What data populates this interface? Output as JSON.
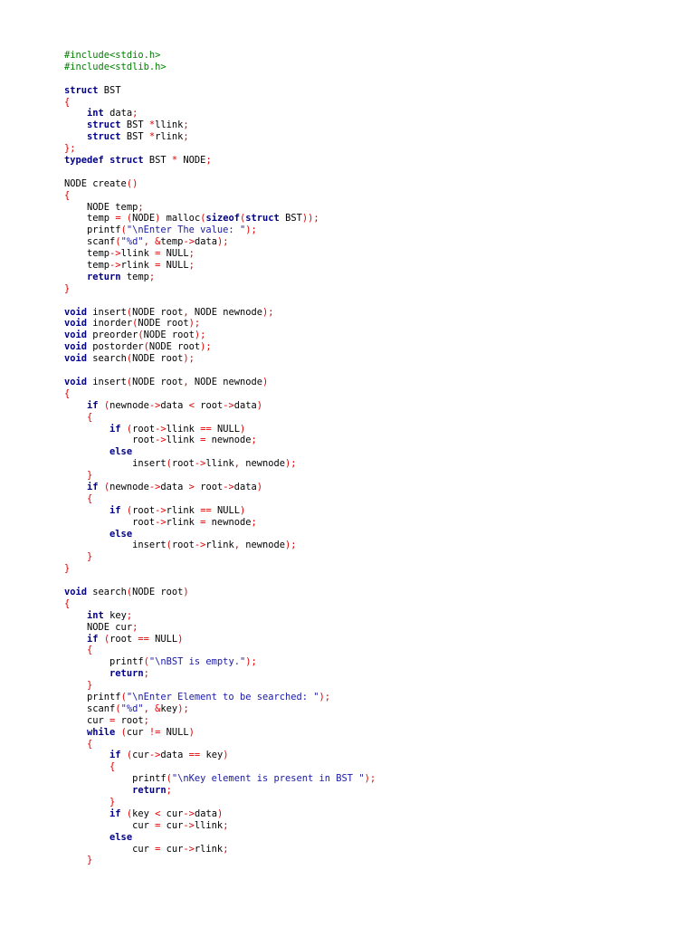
{
  "colors": {
    "preprocessor": "#008000",
    "keyword": "#00008b",
    "string": "#1a1aa6",
    "operator": "#e00000",
    "text": "#000000",
    "background": "#ffffff"
  },
  "code": {
    "lines": [
      [
        [
          "pp",
          "#include<stdio.h>"
        ]
      ],
      [
        [
          "pp",
          "#include<stdlib.h>"
        ]
      ],
      [],
      [
        [
          "kw",
          "struct"
        ],
        [
          "tx",
          " BST"
        ]
      ],
      [
        [
          "op",
          "{"
        ]
      ],
      [
        [
          "tx",
          "    "
        ],
        [
          "kw",
          "int"
        ],
        [
          "tx",
          " data"
        ],
        [
          "op",
          ";"
        ]
      ],
      [
        [
          "tx",
          "    "
        ],
        [
          "kw",
          "struct"
        ],
        [
          "tx",
          " BST "
        ],
        [
          "op",
          "*"
        ],
        [
          "tx",
          "llink"
        ],
        [
          "op",
          ";"
        ]
      ],
      [
        [
          "tx",
          "    "
        ],
        [
          "kw",
          "struct"
        ],
        [
          "tx",
          " BST "
        ],
        [
          "op",
          "*"
        ],
        [
          "tx",
          "rlink"
        ],
        [
          "op",
          ";"
        ]
      ],
      [
        [
          "op",
          "};"
        ]
      ],
      [
        [
          "kw",
          "typedef"
        ],
        [
          "tx",
          " "
        ],
        [
          "kw",
          "struct"
        ],
        [
          "tx",
          " BST "
        ],
        [
          "op",
          "*"
        ],
        [
          "tx",
          " NODE"
        ],
        [
          "op",
          ";"
        ]
      ],
      [],
      [
        [
          "tx",
          "NODE create"
        ],
        [
          "op",
          "()"
        ]
      ],
      [
        [
          "op",
          "{"
        ]
      ],
      [
        [
          "tx",
          "    NODE temp"
        ],
        [
          "op",
          ";"
        ]
      ],
      [
        [
          "tx",
          "    temp "
        ],
        [
          "op",
          "="
        ],
        [
          "tx",
          " "
        ],
        [
          "op",
          "("
        ],
        [
          "tx",
          "NODE"
        ],
        [
          "op",
          ")"
        ],
        [
          "tx",
          " malloc"
        ],
        [
          "op",
          "("
        ],
        [
          "kw",
          "sizeof"
        ],
        [
          "op",
          "("
        ],
        [
          "kw",
          "struct"
        ],
        [
          "tx",
          " BST"
        ],
        [
          "op",
          "));"
        ]
      ],
      [
        [
          "tx",
          "    printf"
        ],
        [
          "op",
          "("
        ],
        [
          "st",
          "\"\\nEnter The value: \""
        ],
        [
          "op",
          ");"
        ]
      ],
      [
        [
          "tx",
          "    scanf"
        ],
        [
          "op",
          "("
        ],
        [
          "st",
          "\"%d\""
        ],
        [
          "op",
          ","
        ],
        [
          "tx",
          " "
        ],
        [
          "op",
          "&"
        ],
        [
          "tx",
          "temp"
        ],
        [
          "op",
          "->"
        ],
        [
          "tx",
          "data"
        ],
        [
          "op",
          ");"
        ]
      ],
      [
        [
          "tx",
          "    temp"
        ],
        [
          "op",
          "->"
        ],
        [
          "tx",
          "llink "
        ],
        [
          "op",
          "="
        ],
        [
          "tx",
          " NULL"
        ],
        [
          "op",
          ";"
        ]
      ],
      [
        [
          "tx",
          "    temp"
        ],
        [
          "op",
          "->"
        ],
        [
          "tx",
          "rlink "
        ],
        [
          "op",
          "="
        ],
        [
          "tx",
          " NULL"
        ],
        [
          "op",
          ";"
        ]
      ],
      [
        [
          "tx",
          "    "
        ],
        [
          "kw",
          "return"
        ],
        [
          "tx",
          " temp"
        ],
        [
          "op",
          ";"
        ]
      ],
      [
        [
          "op",
          "}"
        ]
      ],
      [],
      [
        [
          "kw",
          "void"
        ],
        [
          "tx",
          " insert"
        ],
        [
          "op",
          "("
        ],
        [
          "tx",
          "NODE root"
        ],
        [
          "op",
          ","
        ],
        [
          "tx",
          " NODE newnode"
        ],
        [
          "op",
          ");"
        ]
      ],
      [
        [
          "kw",
          "void"
        ],
        [
          "tx",
          " inorder"
        ],
        [
          "op",
          "("
        ],
        [
          "tx",
          "NODE root"
        ],
        [
          "op",
          ");"
        ]
      ],
      [
        [
          "kw",
          "void"
        ],
        [
          "tx",
          " preorder"
        ],
        [
          "op",
          "("
        ],
        [
          "tx",
          "NODE root"
        ],
        [
          "op",
          ");"
        ]
      ],
      [
        [
          "kw",
          "void"
        ],
        [
          "tx",
          " postorder"
        ],
        [
          "op",
          "("
        ],
        [
          "tx",
          "NODE root"
        ],
        [
          "op",
          ");"
        ]
      ],
      [
        [
          "kw",
          "void"
        ],
        [
          "tx",
          " search"
        ],
        [
          "op",
          "("
        ],
        [
          "tx",
          "NODE root"
        ],
        [
          "op",
          ");"
        ]
      ],
      [],
      [
        [
          "kw",
          "void"
        ],
        [
          "tx",
          " insert"
        ],
        [
          "op",
          "("
        ],
        [
          "tx",
          "NODE root"
        ],
        [
          "op",
          ","
        ],
        [
          "tx",
          " NODE newnode"
        ],
        [
          "op",
          ")"
        ]
      ],
      [
        [
          "op",
          "{"
        ]
      ],
      [
        [
          "tx",
          "    "
        ],
        [
          "kw",
          "if"
        ],
        [
          "tx",
          " "
        ],
        [
          "op",
          "("
        ],
        [
          "tx",
          "newnode"
        ],
        [
          "op",
          "->"
        ],
        [
          "tx",
          "data "
        ],
        [
          "op",
          "<"
        ],
        [
          "tx",
          " root"
        ],
        [
          "op",
          "->"
        ],
        [
          "tx",
          "data"
        ],
        [
          "op",
          ")"
        ]
      ],
      [
        [
          "tx",
          "    "
        ],
        [
          "op",
          "{"
        ]
      ],
      [
        [
          "tx",
          "        "
        ],
        [
          "kw",
          "if"
        ],
        [
          "tx",
          " "
        ],
        [
          "op",
          "("
        ],
        [
          "tx",
          "root"
        ],
        [
          "op",
          "->"
        ],
        [
          "tx",
          "llink "
        ],
        [
          "op",
          "=="
        ],
        [
          "tx",
          " NULL"
        ],
        [
          "op",
          ")"
        ]
      ],
      [
        [
          "tx",
          "            root"
        ],
        [
          "op",
          "->"
        ],
        [
          "tx",
          "llink "
        ],
        [
          "op",
          "="
        ],
        [
          "tx",
          " newnode"
        ],
        [
          "op",
          ";"
        ]
      ],
      [
        [
          "tx",
          "        "
        ],
        [
          "kw",
          "else"
        ]
      ],
      [
        [
          "tx",
          "            insert"
        ],
        [
          "op",
          "("
        ],
        [
          "tx",
          "root"
        ],
        [
          "op",
          "->"
        ],
        [
          "tx",
          "llink"
        ],
        [
          "op",
          ","
        ],
        [
          "tx",
          " newnode"
        ],
        [
          "op",
          ");"
        ]
      ],
      [
        [
          "tx",
          "    "
        ],
        [
          "op",
          "}"
        ]
      ],
      [
        [
          "tx",
          "    "
        ],
        [
          "kw",
          "if"
        ],
        [
          "tx",
          " "
        ],
        [
          "op",
          "("
        ],
        [
          "tx",
          "newnode"
        ],
        [
          "op",
          "->"
        ],
        [
          "tx",
          "data "
        ],
        [
          "op",
          ">"
        ],
        [
          "tx",
          " root"
        ],
        [
          "op",
          "->"
        ],
        [
          "tx",
          "data"
        ],
        [
          "op",
          ")"
        ]
      ],
      [
        [
          "tx",
          "    "
        ],
        [
          "op",
          "{"
        ]
      ],
      [
        [
          "tx",
          "        "
        ],
        [
          "kw",
          "if"
        ],
        [
          "tx",
          " "
        ],
        [
          "op",
          "("
        ],
        [
          "tx",
          "root"
        ],
        [
          "op",
          "->"
        ],
        [
          "tx",
          "rlink "
        ],
        [
          "op",
          "=="
        ],
        [
          "tx",
          " NULL"
        ],
        [
          "op",
          ")"
        ]
      ],
      [
        [
          "tx",
          "            root"
        ],
        [
          "op",
          "->"
        ],
        [
          "tx",
          "rlink "
        ],
        [
          "op",
          "="
        ],
        [
          "tx",
          " newnode"
        ],
        [
          "op",
          ";"
        ]
      ],
      [
        [
          "tx",
          "        "
        ],
        [
          "kw",
          "else"
        ]
      ],
      [
        [
          "tx",
          "            insert"
        ],
        [
          "op",
          "("
        ],
        [
          "tx",
          "root"
        ],
        [
          "op",
          "->"
        ],
        [
          "tx",
          "rlink"
        ],
        [
          "op",
          ","
        ],
        [
          "tx",
          " newnode"
        ],
        [
          "op",
          ");"
        ]
      ],
      [
        [
          "tx",
          "    "
        ],
        [
          "op",
          "}"
        ]
      ],
      [
        [
          "op",
          "}"
        ]
      ],
      [],
      [
        [
          "kw",
          "void"
        ],
        [
          "tx",
          " search"
        ],
        [
          "op",
          "("
        ],
        [
          "tx",
          "NODE root"
        ],
        [
          "op",
          ")"
        ]
      ],
      [
        [
          "op",
          "{"
        ]
      ],
      [
        [
          "tx",
          "    "
        ],
        [
          "kw",
          "int"
        ],
        [
          "tx",
          " key"
        ],
        [
          "op",
          ";"
        ]
      ],
      [
        [
          "tx",
          "    NODE cur"
        ],
        [
          "op",
          ";"
        ]
      ],
      [
        [
          "tx",
          "    "
        ],
        [
          "kw",
          "if"
        ],
        [
          "tx",
          " "
        ],
        [
          "op",
          "("
        ],
        [
          "tx",
          "root "
        ],
        [
          "op",
          "=="
        ],
        [
          "tx",
          " NULL"
        ],
        [
          "op",
          ")"
        ]
      ],
      [
        [
          "tx",
          "    "
        ],
        [
          "op",
          "{"
        ]
      ],
      [
        [
          "tx",
          "        printf"
        ],
        [
          "op",
          "("
        ],
        [
          "st",
          "\"\\nBST is empty.\""
        ],
        [
          "op",
          ");"
        ]
      ],
      [
        [
          "tx",
          "        "
        ],
        [
          "kw",
          "return"
        ],
        [
          "op",
          ";"
        ]
      ],
      [
        [
          "tx",
          "    "
        ],
        [
          "op",
          "}"
        ]
      ],
      [
        [
          "tx",
          "    printf"
        ],
        [
          "op",
          "("
        ],
        [
          "st",
          "\"\\nEnter Element to be searched: \""
        ],
        [
          "op",
          ");"
        ]
      ],
      [
        [
          "tx",
          "    scanf"
        ],
        [
          "op",
          "("
        ],
        [
          "st",
          "\"%d\""
        ],
        [
          "op",
          ","
        ],
        [
          "tx",
          " "
        ],
        [
          "op",
          "&"
        ],
        [
          "tx",
          "key"
        ],
        [
          "op",
          ");"
        ]
      ],
      [
        [
          "tx",
          "    cur "
        ],
        [
          "op",
          "="
        ],
        [
          "tx",
          " root"
        ],
        [
          "op",
          ";"
        ]
      ],
      [
        [
          "tx",
          "    "
        ],
        [
          "kw",
          "while"
        ],
        [
          "tx",
          " "
        ],
        [
          "op",
          "("
        ],
        [
          "tx",
          "cur "
        ],
        [
          "op",
          "!="
        ],
        [
          "tx",
          " NULL"
        ],
        [
          "op",
          ")"
        ]
      ],
      [
        [
          "tx",
          "    "
        ],
        [
          "op",
          "{"
        ]
      ],
      [
        [
          "tx",
          "        "
        ],
        [
          "kw",
          "if"
        ],
        [
          "tx",
          " "
        ],
        [
          "op",
          "("
        ],
        [
          "tx",
          "cur"
        ],
        [
          "op",
          "->"
        ],
        [
          "tx",
          "data "
        ],
        [
          "op",
          "=="
        ],
        [
          "tx",
          " key"
        ],
        [
          "op",
          ")"
        ]
      ],
      [
        [
          "tx",
          "        "
        ],
        [
          "op",
          "{"
        ]
      ],
      [
        [
          "tx",
          "            printf"
        ],
        [
          "op",
          "("
        ],
        [
          "st",
          "\"\\nKey element is present in BST \""
        ],
        [
          "op",
          ");"
        ]
      ],
      [
        [
          "tx",
          "            "
        ],
        [
          "kw",
          "return"
        ],
        [
          "op",
          ";"
        ]
      ],
      [
        [
          "tx",
          "        "
        ],
        [
          "op",
          "}"
        ]
      ],
      [
        [
          "tx",
          "        "
        ],
        [
          "kw",
          "if"
        ],
        [
          "tx",
          " "
        ],
        [
          "op",
          "("
        ],
        [
          "tx",
          "key "
        ],
        [
          "op",
          "<"
        ],
        [
          "tx",
          " cur"
        ],
        [
          "op",
          "->"
        ],
        [
          "tx",
          "data"
        ],
        [
          "op",
          ")"
        ]
      ],
      [
        [
          "tx",
          "            cur "
        ],
        [
          "op",
          "="
        ],
        [
          "tx",
          " cur"
        ],
        [
          "op",
          "->"
        ],
        [
          "tx",
          "llink"
        ],
        [
          "op",
          ";"
        ]
      ],
      [
        [
          "tx",
          "        "
        ],
        [
          "kw",
          "else"
        ]
      ],
      [
        [
          "tx",
          "            cur "
        ],
        [
          "op",
          "="
        ],
        [
          "tx",
          " cur"
        ],
        [
          "op",
          "->"
        ],
        [
          "tx",
          "rlink"
        ],
        [
          "op",
          ";"
        ]
      ],
      [
        [
          "tx",
          "    "
        ],
        [
          "op",
          "}"
        ]
      ]
    ]
  }
}
